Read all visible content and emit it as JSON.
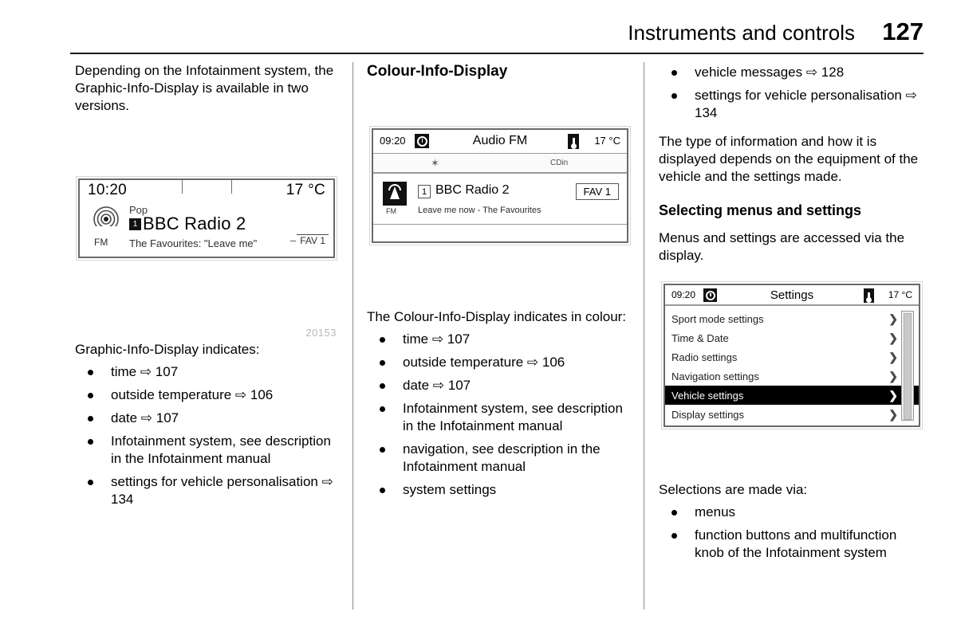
{
  "header": {
    "title": "Instruments and controls",
    "page_number": "127"
  },
  "left_column": {
    "intro": "Depending on the Infotainment system, the Graphic-Info-Display is available in two versions.",
    "figure_caption": "20153",
    "graphic_info_display": {
      "time": "10:20",
      "temperature": "17 °C",
      "band_label": "FM",
      "genre": "Pop",
      "preset_number": "1",
      "station": "BBC Radio 2",
      "track": "The Favourites: \"Leave me\"",
      "fav_dash": "–",
      "fav_label": "FAV 1"
    },
    "list_intro": "Graphic-Info-Display indicates:",
    "items": [
      "time ⇨ 107",
      "outside temperature ⇨ 106",
      "date ⇨ 107",
      "Infotainment system, see description in the Infotainment manual",
      "settings for vehicle personalisation ⇨ 134"
    ]
  },
  "middle_column": {
    "heading": "Colour-Info-Display",
    "colour_info_display": {
      "time": "09:20",
      "title": "Audio FM",
      "temperature": "17 °C",
      "bluetooth_icon": "✶",
      "cd_status": "CDin",
      "band_label": "FM",
      "preset_number": "1",
      "station": "BBC Radio 2",
      "track": "Leave me now - The Favourites",
      "fav_button": "FAV 1"
    },
    "list_intro": "The Colour-Info-Display indicates in colour:",
    "items": [
      "time ⇨ 107",
      "outside temperature ⇨ 106",
      "date ⇨ 107",
      "Infotainment system, see description in the Infotainment manual",
      "navigation, see description in the Infotainment manual",
      "system settings"
    ]
  },
  "right_column": {
    "top_items": [
      "vehicle messages ⇨ 128",
      "settings for vehicle personalisation ⇨ 134"
    ],
    "paragraph": "The type of information and how it is displayed depends on the equipment of the vehicle and the settings made.",
    "heading": "Selecting menus and settings",
    "heading_paragraph": "Menus and settings are accessed via the display.",
    "settings_screen": {
      "time": "09:20",
      "title": "Settings",
      "temperature": "17 °C",
      "rows": [
        {
          "label": "Sport mode settings",
          "selected": false
        },
        {
          "label": "Time & Date",
          "selected": false
        },
        {
          "label": "Radio settings",
          "selected": false
        },
        {
          "label": "Navigation settings",
          "selected": false
        },
        {
          "label": "Vehicle settings",
          "selected": true
        },
        {
          "label": "Display settings",
          "selected": false
        }
      ],
      "chevron": "❯"
    },
    "list_intro": "Selections are made via:",
    "bottom_items": [
      "menus",
      "function buttons and multifunction knob of the Infotainment system"
    ]
  }
}
